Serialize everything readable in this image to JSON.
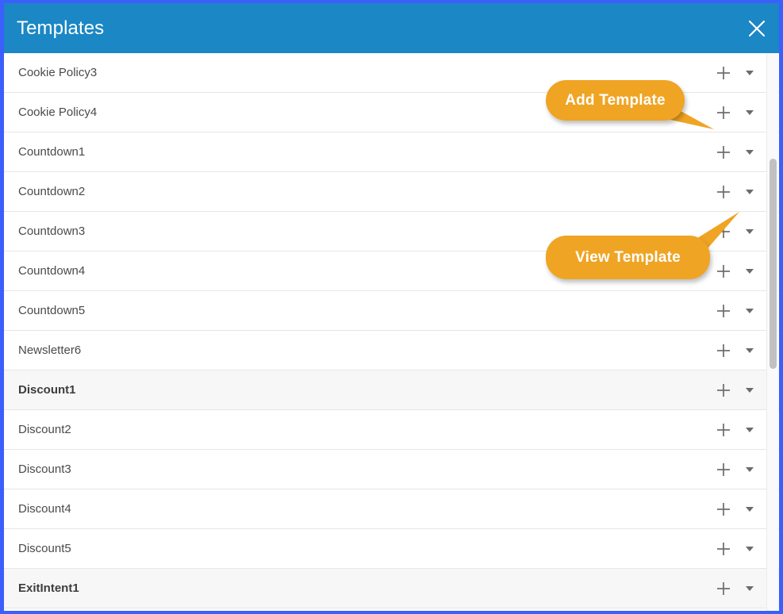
{
  "modal": {
    "title": "Templates",
    "close_icon": "close-icon",
    "accent_border_color": "#3b5ffb",
    "header_color": "#1b87c4",
    "callout_color": "#efa423"
  },
  "callouts": [
    {
      "id": "add-template",
      "label": "Add Template",
      "points_to": "add-icon"
    },
    {
      "id": "view-template",
      "label": "View Template",
      "points_to": "caret-icon"
    }
  ],
  "list": {
    "add_icon": "plus-icon",
    "caret_icon": "chevron-down-icon",
    "rows": [
      {
        "name": "Cookie Policy3",
        "highlighted": false
      },
      {
        "name": "Cookie Policy4",
        "highlighted": false
      },
      {
        "name": "Countdown1",
        "highlighted": false
      },
      {
        "name": "Countdown2",
        "highlighted": false
      },
      {
        "name": "Countdown3",
        "highlighted": false
      },
      {
        "name": "Countdown4",
        "highlighted": false
      },
      {
        "name": "Countdown5",
        "highlighted": false
      },
      {
        "name": "Newsletter6",
        "highlighted": false
      },
      {
        "name": "Discount1",
        "highlighted": true
      },
      {
        "name": "Discount2",
        "highlighted": false
      },
      {
        "name": "Discount3",
        "highlighted": false
      },
      {
        "name": "Discount4",
        "highlighted": false
      },
      {
        "name": "Discount5",
        "highlighted": false
      },
      {
        "name": "ExitIntent1",
        "highlighted": true
      }
    ]
  },
  "scrollbar": {
    "orientation": "vertical"
  }
}
